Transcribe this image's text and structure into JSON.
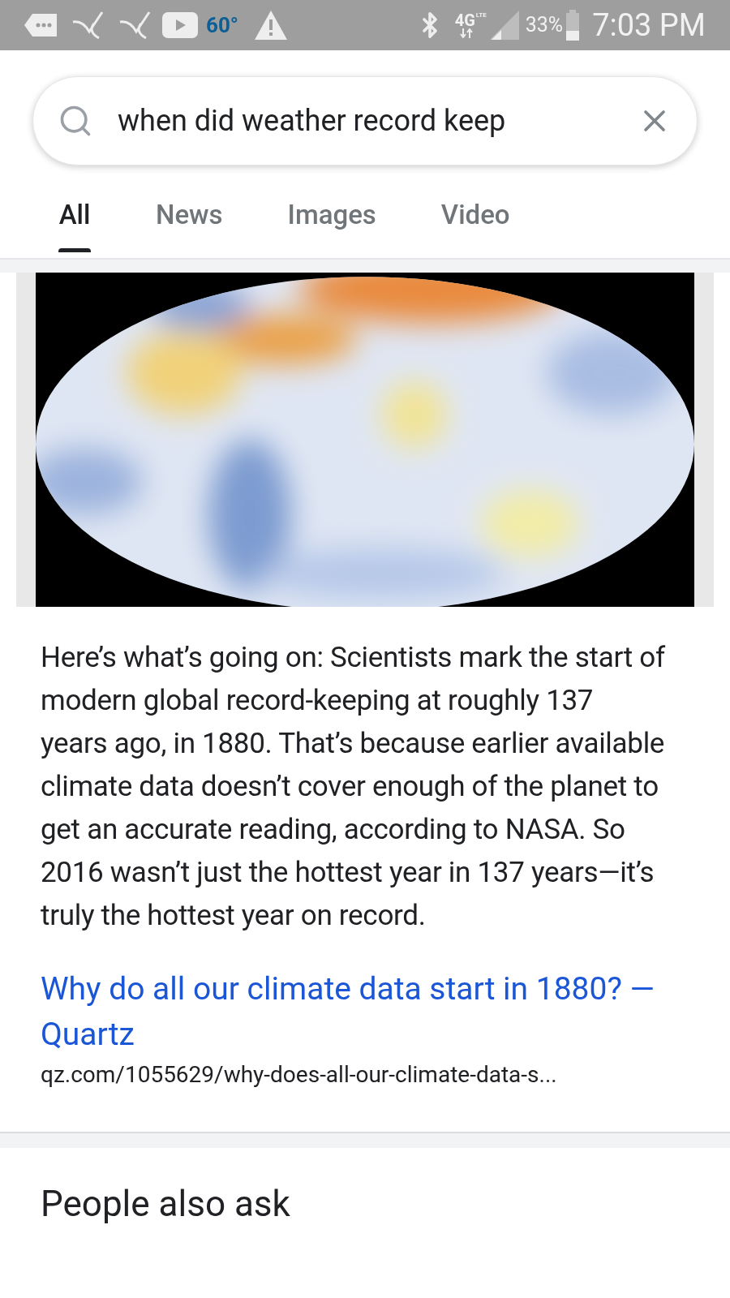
{
  "status_bar": {
    "temperature": "60°",
    "network": "4G",
    "network_sub": "LTE",
    "battery": "33%",
    "time": "7:03 PM"
  },
  "search": {
    "value": "when did weather record keep"
  },
  "tabs": [
    {
      "label": "All",
      "selected": true
    },
    {
      "label": "News",
      "selected": false
    },
    {
      "label": "Images",
      "selected": false
    },
    {
      "label": "Video",
      "selected": false
    }
  ],
  "result": {
    "snippet": "Here’s what’s going on: Scientists mark the start of modern global record-keeping at roughly 137 years ago, in 1880. That’s because earlier available climate data doesn’t cover enough of the planet to get an accurate reading, according to NASA. So 2016 wasn’t just the hottest year in 137 years—it’s truly the hottest year on record.",
    "link_title": "Why do all our climate data start in 1880? — Quartz",
    "url": "qz.com/1055629/why-does-all-our-climate-data-s..."
  },
  "section_title": "People also ask"
}
